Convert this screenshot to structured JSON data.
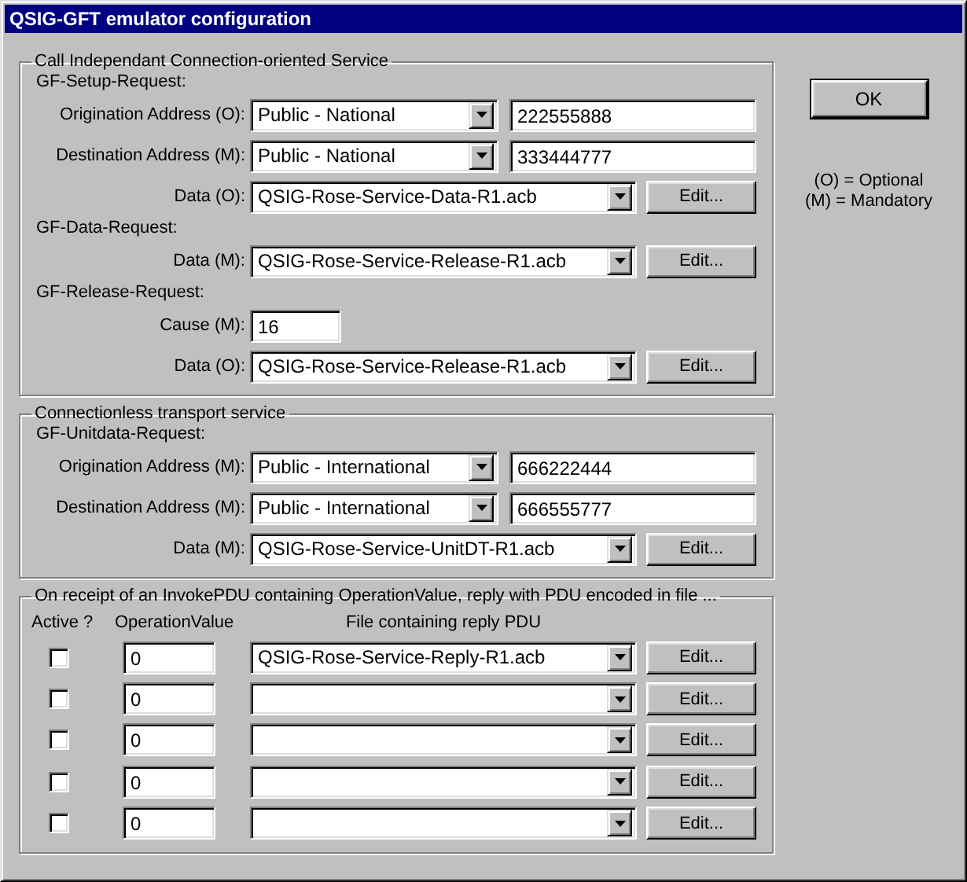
{
  "window": {
    "title": "QSIG-GFT emulator configuration"
  },
  "sections": [
    {
      "title": "Call Independant Connection-oriented Service",
      "requests": [
        {
          "title": "GF-Setup-Request:",
          "fields": [
            {
              "kind": "address",
              "label": "Origination Address (O):",
              "value": "Public - National",
              "number": "222555888"
            },
            {
              "kind": "address",
              "label": "Destination Address (M):",
              "value": "Public - National",
              "number": "333444777"
            },
            {
              "kind": "file",
              "label": "Data (O):",
              "value": "QSIG-Rose-Service-Data-R1.acb",
              "button": "Edit..."
            }
          ]
        },
        {
          "title": "GF-Data-Request:",
          "fields": [
            {
              "kind": "file",
              "label": "Data (M):",
              "value": "QSIG-Rose-Service-Release-R1.acb",
              "button": "Edit..."
            }
          ]
        },
        {
          "title": "GF-Release-Request:",
          "fields": [
            {
              "kind": "text",
              "label": "Cause (M):",
              "value": "16"
            },
            {
              "kind": "file",
              "label": "Data (O):",
              "value": "QSIG-Rose-Service-Release-R1.acb",
              "button": "Edit..."
            }
          ]
        }
      ]
    },
    {
      "title": "Connectionless transport service",
      "requests": [
        {
          "title": "GF-Unitdata-Request:",
          "fields": [
            {
              "kind": "address",
              "label": "Origination Address (M):",
              "value": "Public - International",
              "number": "666222444"
            },
            {
              "kind": "address",
              "label": "Destination Address (M):",
              "value": "Public - International",
              "number": "666555777"
            },
            {
              "kind": "file",
              "label": "Data (M):",
              "value": "QSIG-Rose-Service-UnitDT-R1.acb",
              "button": "Edit..."
            }
          ]
        }
      ]
    }
  ],
  "reply_table": {
    "title": "On receipt of an InvokePDU containing OperationValue, reply with PDU encoded in file ...",
    "columns": [
      "Active ?",
      "OperationValue",
      "File containing reply PDU"
    ],
    "rows": [
      {
        "active": false,
        "operation_value": "0",
        "file": "QSIG-Rose-Service-Reply-R1.acb",
        "button": "Edit..."
      },
      {
        "active": false,
        "operation_value": "0",
        "button": "Edit..."
      },
      {
        "active": false,
        "operation_value": "0",
        "button": "Edit..."
      },
      {
        "active": false,
        "operation_value": "0",
        "button": "Edit..."
      },
      {
        "active": false,
        "operation_value": "0",
        "button": "Edit..."
      }
    ]
  },
  "ok_button": "OK",
  "legend": [
    "(O) = Optional",
    "(M) = Mandatory"
  ]
}
